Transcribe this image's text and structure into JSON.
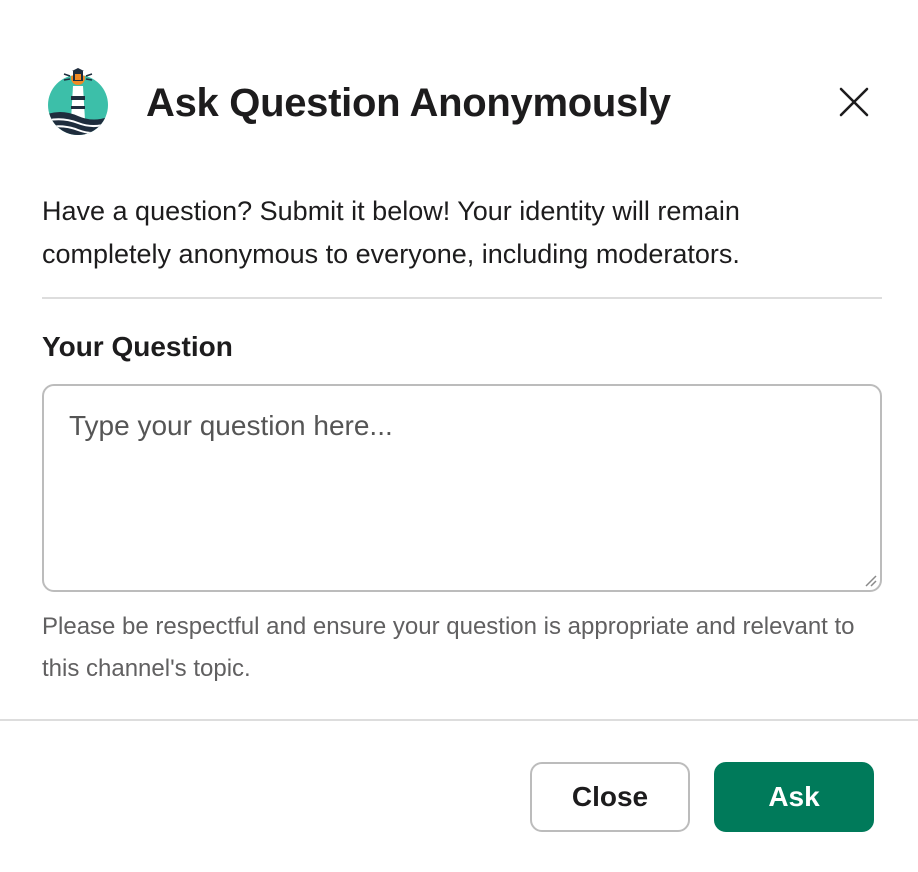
{
  "modal": {
    "title": "Ask Question Anonymously",
    "app_icon": "lighthouse-logo-icon",
    "close_icon": "close-icon",
    "description": "Have a question? Submit it below! Your identity will remain completely anonymous to everyone, including moderators."
  },
  "form": {
    "question_label": "Your Question",
    "question_placeholder": "Type your question here...",
    "question_value": "",
    "hint": "Please be respectful and ensure your question is appropriate and relevant to this channel's topic."
  },
  "footer": {
    "close_label": "Close",
    "ask_label": "Ask"
  },
  "colors": {
    "primary": "#007a5a",
    "border": "#bcbcbc",
    "divider": "#dddddd",
    "hint_text": "#616061",
    "logo_teal": "#3cbfa9",
    "logo_orange": "#f08a24",
    "logo_navy": "#1f2d3d"
  }
}
